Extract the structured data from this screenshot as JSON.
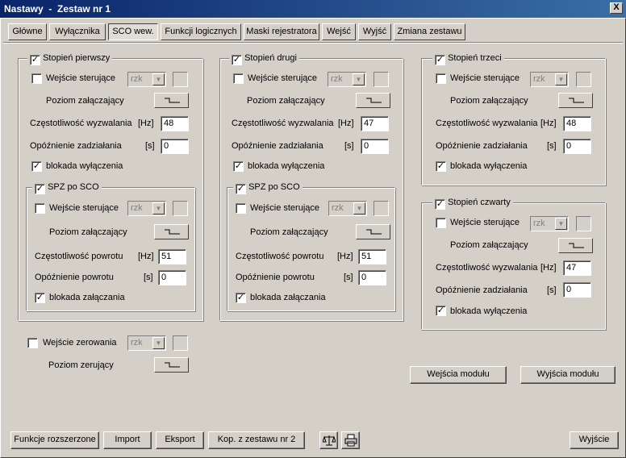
{
  "window": {
    "title": "Nastawy  -  Zestaw nr 1",
    "close_label": "X"
  },
  "tabs": [
    "Główne",
    "Wyłącznika",
    "SCO wew.",
    "Funkcji logicznych",
    "Maski rejestratora",
    "Wejść",
    "Wyjść",
    "Zmiana zestawu"
  ],
  "active_tab": "SCO wew.",
  "common": {
    "control_input": "Wejście sterujące",
    "combo_value": "rzk",
    "switch_level": "Poziom załączający",
    "trip_freq": "Częstotliwość wyzwalania",
    "trip_delay": "Opóźnienie zadziałania",
    "hz": "[Hz]",
    "s": "[s]",
    "block_trip": "blokada wyłączenia",
    "spz": "SPZ po SCO",
    "return_freq": "Częstotliwość powrotu",
    "return_delay": "Opóźnienie powrotu",
    "block_close": "blokada załączania"
  },
  "stage1": {
    "title": "Stopień pierwszy",
    "freq": "48",
    "delay": "0",
    "spz_freq": "51",
    "spz_delay": "0"
  },
  "stage2": {
    "title": "Stopień drugi",
    "freq": "47",
    "delay": "0",
    "spz_freq": "51",
    "spz_delay": "0"
  },
  "stage3": {
    "title": "Stopień trzeci",
    "freq": "48",
    "delay": "0"
  },
  "stage4": {
    "title": "Stopień czwarty",
    "freq": "47",
    "delay": "0"
  },
  "reset": {
    "input_label": "Wejście zerowania",
    "combo_value": "rzk",
    "level_label": "Poziom zerujący"
  },
  "buttons": {
    "module_inputs": "Wejścia modułu",
    "module_outputs": "Wyjścia modułu",
    "extended": "Funkcje rozszerzone",
    "import": "Import",
    "export": "Eksport",
    "copy": "Kop. z zestawu nr 2",
    "exit": "Wyjście"
  },
  "icons": {
    "scale": "scale-icon",
    "print": "printer-icon"
  }
}
